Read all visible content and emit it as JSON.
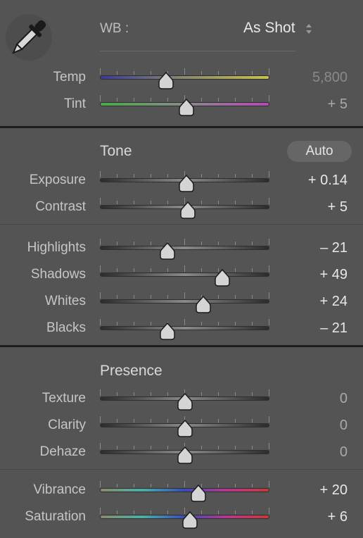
{
  "wb": {
    "label": "WB :",
    "value": "As Shot"
  },
  "tone": {
    "title": "Tone",
    "auto_label": "Auto"
  },
  "presence": {
    "title": "Presence"
  },
  "colors": {
    "background": "#545454",
    "temp_gradient": [
      "#3b3b9a",
      "#8a8a70",
      "#c9c14a"
    ],
    "tint_gradient": [
      "#4aa84a",
      "#8a8a8a",
      "#b44ab4"
    ],
    "neutral_track": [
      "#2c2c2c",
      "#8a8a8a"
    ],
    "vibrance_gradient": [
      "#8a8a6a",
      "#4bb0a8",
      "#3a4bb5",
      "#b33a8a",
      "#c43a3a"
    ]
  },
  "sliders": [
    {
      "key": "temp",
      "label": "Temp",
      "value": "5,800",
      "position": 0.39,
      "track": "temp",
      "value_style": "dim"
    },
    {
      "key": "tint",
      "label": "Tint",
      "value": "+ 5",
      "position": 0.51,
      "track": "tint",
      "value_style": "muted"
    },
    {
      "key": "exposure",
      "label": "Exposure",
      "value": "+ 0.14",
      "position": 0.51,
      "track": "neutral",
      "value_style": "normal"
    },
    {
      "key": "contrast",
      "label": "Contrast",
      "value": "+ 5",
      "position": 0.52,
      "track": "neutral",
      "value_style": "normal"
    },
    {
      "key": "highlights",
      "label": "Highlights",
      "value": "– 21",
      "position": 0.4,
      "track": "neutral",
      "value_style": "normal"
    },
    {
      "key": "shadows",
      "label": "Shadows",
      "value": "+ 49",
      "position": 0.72,
      "track": "neutral",
      "value_style": "normal"
    },
    {
      "key": "whites",
      "label": "Whites",
      "value": "+ 24",
      "position": 0.61,
      "track": "neutral",
      "value_style": "normal"
    },
    {
      "key": "blacks",
      "label": "Blacks",
      "value": "– 21",
      "position": 0.4,
      "track": "neutral",
      "value_style": "normal"
    },
    {
      "key": "texture",
      "label": "Texture",
      "value": "0",
      "position": 0.5,
      "track": "neutral",
      "value_style": "muted"
    },
    {
      "key": "clarity",
      "label": "Clarity",
      "value": "0",
      "position": 0.5,
      "track": "neutral",
      "value_style": "muted"
    },
    {
      "key": "dehaze",
      "label": "Dehaze",
      "value": "0",
      "position": 0.5,
      "track": "neutral",
      "value_style": "muted"
    },
    {
      "key": "vibrance",
      "label": "Vibrance",
      "value": "+ 20",
      "position": 0.58,
      "track": "vibrance",
      "value_style": "normal"
    },
    {
      "key": "saturation",
      "label": "Saturation",
      "value": "+ 6",
      "position": 0.53,
      "track": "vibrance",
      "value_style": "normal"
    }
  ]
}
